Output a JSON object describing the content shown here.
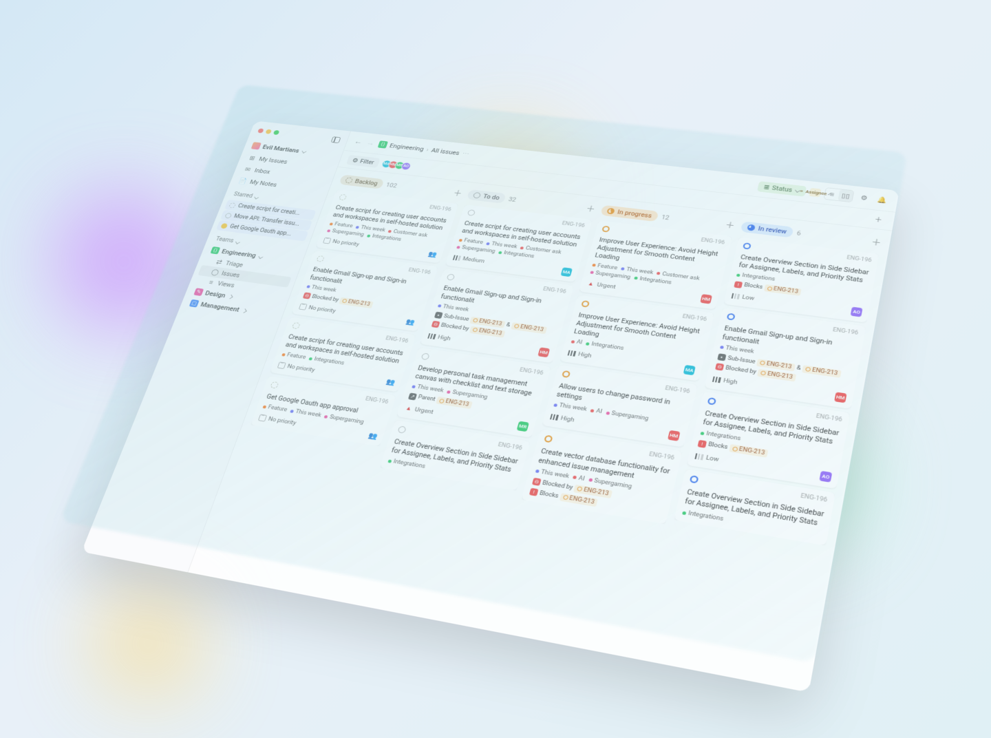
{
  "workspace": {
    "name": "Evil Martians"
  },
  "sidebar": {
    "primary": [
      {
        "icon": "⊞",
        "label": "My Issues"
      },
      {
        "icon": "✉",
        "label": "Inbox"
      },
      {
        "icon": "📄",
        "label": "My Notes"
      }
    ],
    "starred_label": "Starred",
    "starred": [
      {
        "label": "Create script for creati..."
      },
      {
        "label": "Move API: Transfer issu..."
      },
      {
        "label": "Get Google Oauth app..."
      }
    ],
    "teams_label": "Teams",
    "teams": [
      {
        "name": "Engineering",
        "color": "#22c55e",
        "expanded": true,
        "children": [
          {
            "label": "Triage",
            "icon": "⇄"
          },
          {
            "label": "Issues",
            "icon": "◯",
            "active": true
          },
          {
            "label": "Views",
            "icon": "≡"
          }
        ]
      },
      {
        "name": "Design",
        "color": "#ec4899"
      },
      {
        "name": "Management",
        "color": "#3b82f6"
      }
    ]
  },
  "breadcrumb": {
    "team": "Engineering",
    "view": "All issues"
  },
  "group_by": {
    "status_label": "Status",
    "assignee_label": "Assignee"
  },
  "filter_label": "Filter",
  "avatars": [
    {
      "initials": "MA",
      "color": "#06b6d4"
    },
    {
      "initials": "HM",
      "color": "#ef4444"
    },
    {
      "initials": "MR",
      "color": "#22c55e"
    },
    {
      "initials": "AO",
      "color": "#8b5cf6"
    }
  ],
  "tag_colors": {
    "Feature": "#f97316",
    "This week": "#6366f1",
    "Customer ask": "#ef4444",
    "Supergaming": "#ec4899",
    "Integrations": "#22c55e",
    "AI": "#ef4444"
  },
  "issue_id": "ENG-196",
  "related_id": "ENG-213",
  "columns": [
    {
      "key": "backlog",
      "label": "Backlog",
      "count": 102,
      "cards": [
        {
          "title": "Create script for creating user accounts and workspaces in self-hosted solution",
          "tags": [
            "Feature",
            "This week",
            "Customer ask",
            "Supergaming",
            "Integrations"
          ],
          "priority": "No priority",
          "pair": true
        },
        {
          "title": "Enable Gmail Sign-up and Sign-in functionalit",
          "tags": [
            "This week"
          ],
          "relations": [
            {
              "type": "blocked",
              "label": "Blocked by",
              "link": "ENG-213"
            }
          ],
          "priority": "No priority",
          "pair": true
        },
        {
          "title": "Create script for creating user accounts and workspaces in self-hosted solution",
          "tags": [
            "Feature",
            "Integrations"
          ],
          "priority": "No priority",
          "pair": true
        },
        {
          "title": "Get Google Oauth app approval",
          "tags": [
            "Feature",
            "This week",
            "Supergaming"
          ],
          "priority": "No priority",
          "pair": true
        }
      ]
    },
    {
      "key": "todo",
      "label": "To do",
      "count": 32,
      "cards": [
        {
          "title": "Create script for creating user accounts and workspaces in self-hosted solution",
          "tags": [
            "Feature",
            "This week",
            "Customer ask",
            "Supergaming",
            "Integrations"
          ],
          "priority": "Medium",
          "assignee": {
            "i": "MA",
            "c": "#06b6d4"
          }
        },
        {
          "title": "Enable Gmail Sign-up and Sign-in functionalit",
          "tags": [
            "This week"
          ],
          "relations": [
            {
              "type": "sub",
              "label": "Sub-Issue",
              "link": "ENG-213",
              "link2": "ENG-213"
            },
            {
              "type": "blocked",
              "label": "Blocked by",
              "link": "ENG-213"
            }
          ],
          "priority": "High",
          "assignee": {
            "i": "HM",
            "c": "#ef4444"
          }
        },
        {
          "title": "Develop personal task management canvas with checklist and text storage",
          "tags": [
            "This week",
            "Supergaming"
          ],
          "relations": [
            {
              "type": "parent",
              "label": "Parent",
              "link": "ENG-213"
            }
          ],
          "priority": "Urgent",
          "assignee": {
            "i": "MR",
            "c": "#22c55e"
          }
        },
        {
          "title": "Create Overview Section in Side Sidebar for Assignee, Labels, and Priority Stats",
          "tags": [
            "Integrations"
          ]
        }
      ]
    },
    {
      "key": "progress",
      "label": "In progress",
      "count": 12,
      "cards": [
        {
          "title": "Improve User Experience: Avoid Height Adjustment for Smooth Content Loading",
          "tags": [
            "Feature",
            "This week",
            "Customer ask",
            "Supergaming",
            "Integrations"
          ],
          "priority": "Urgent",
          "assignee": {
            "i": "HM",
            "c": "#ef4444"
          }
        },
        {
          "title": "Improve User Experience: Avoid Height Adjustment for Smooth Content Loading",
          "tags": [
            "AI",
            "Integrations"
          ],
          "priority": "High",
          "assignee": {
            "i": "MA",
            "c": "#06b6d4"
          }
        },
        {
          "title": "Allow users to change password in settings",
          "tags": [
            "This week",
            "AI",
            "Supergaming"
          ],
          "priority": "High",
          "assignee": {
            "i": "HM",
            "c": "#ef4444"
          }
        },
        {
          "title": "Create vector database functionality for enhanced issue management",
          "tags": [
            "This week",
            "AI",
            "Supergaming"
          ],
          "relations": [
            {
              "type": "blocked",
              "label": "Blocked by",
              "link": "ENG-213"
            },
            {
              "type": "blocks",
              "label": "Blocks",
              "link": "ENG-213"
            }
          ]
        }
      ]
    },
    {
      "key": "review",
      "label": "In review",
      "count": 6,
      "cards": [
        {
          "title": "Create Overview Section in Side Sidebar for Assignee, Labels, and Priority Stats",
          "tags": [
            "Integrations"
          ],
          "relations": [
            {
              "type": "blocks",
              "label": "Blocks",
              "link": "ENG-213"
            }
          ],
          "priority": "Low",
          "assignee": {
            "i": "AO",
            "c": "#8b5cf6"
          }
        },
        {
          "title": "Enable Gmail Sign-up and Sign-in functionalit",
          "tags": [
            "This week"
          ],
          "relations": [
            {
              "type": "sub",
              "label": "Sub-Issue",
              "link": "ENG-213",
              "link2": "ENG-213"
            },
            {
              "type": "blocked",
              "label": "Blocked by",
              "link": "ENG-213"
            }
          ],
          "priority": "High",
          "assignee": {
            "i": "HM",
            "c": "#ef4444"
          }
        },
        {
          "title": "Create Overview Section in Side Sidebar for Assignee, Labels, and Priority Stats",
          "tags": [
            "Integrations"
          ],
          "relations": [
            {
              "type": "blocks",
              "label": "Blocks",
              "link": "ENG-213"
            }
          ],
          "priority": "Low",
          "assignee": {
            "i": "AO",
            "c": "#8b5cf6"
          }
        },
        {
          "title": "Create Overview Section in Side Sidebar for Assignee, Labels, and Priority Stats",
          "tags": [
            "Integrations"
          ]
        }
      ]
    }
  ]
}
